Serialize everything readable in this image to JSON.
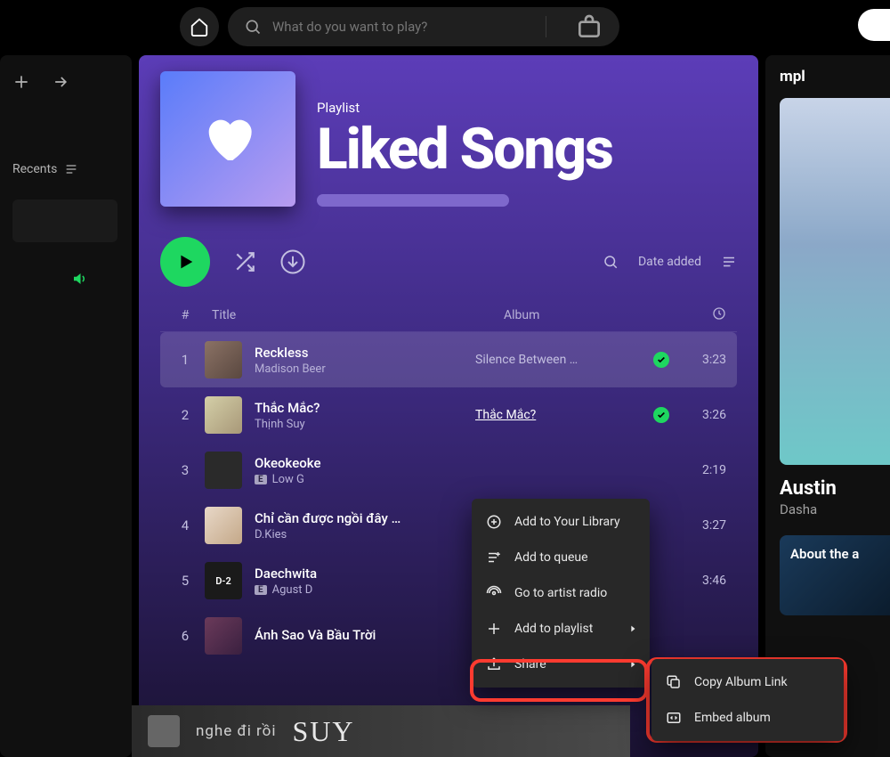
{
  "search": {
    "placeholder": "What do you want to play?"
  },
  "sidebar": {
    "recents": "Recents"
  },
  "header": {
    "type": "Playlist",
    "title": "Liked Songs"
  },
  "controls": {
    "sort": "Date added"
  },
  "columns": {
    "num": "#",
    "title": "Title",
    "album": "Album"
  },
  "tracks": [
    {
      "n": "1",
      "name": "Reckless",
      "artist": "Madison Beer",
      "album": "Silence Between …",
      "dur": "3:23",
      "check": true
    },
    {
      "n": "2",
      "name": "Thắc Mắc?",
      "artist": "Thịnh Suy",
      "album": "Thắc Mắc?",
      "dur": "3:26",
      "check": true,
      "albumLink": true
    },
    {
      "n": "3",
      "name": "Okeokeoke",
      "artist": "Low G",
      "album": "",
      "dur": "2:19",
      "explicit": true
    },
    {
      "n": "4",
      "name": "Chỉ cần được ngồi đây …",
      "artist": "D.Kies",
      "album": "",
      "dur": "3:27"
    },
    {
      "n": "5",
      "name": "Daechwita",
      "artist": "Agust D",
      "album": "",
      "dur": "3:46",
      "explicit": true
    },
    {
      "n": "6",
      "name": "Ánh Sao Và Bầu Trời",
      "artist": "",
      "album": "",
      "dur": ""
    }
  ],
  "menu": {
    "addLibrary": "Add to Your Library",
    "addQueue": "Add to queue",
    "artistRadio": "Go to artist radio",
    "addPlaylist": "Add to playlist",
    "share": "Share"
  },
  "submenu": {
    "copy": "Copy Album Link",
    "embed": "Embed album"
  },
  "banner": {
    "t1": "nghe đi rồi",
    "t2": "SUY"
  },
  "right": {
    "title": "mpl",
    "song": "Austin",
    "artist": "Dasha",
    "about": "About the a"
  }
}
